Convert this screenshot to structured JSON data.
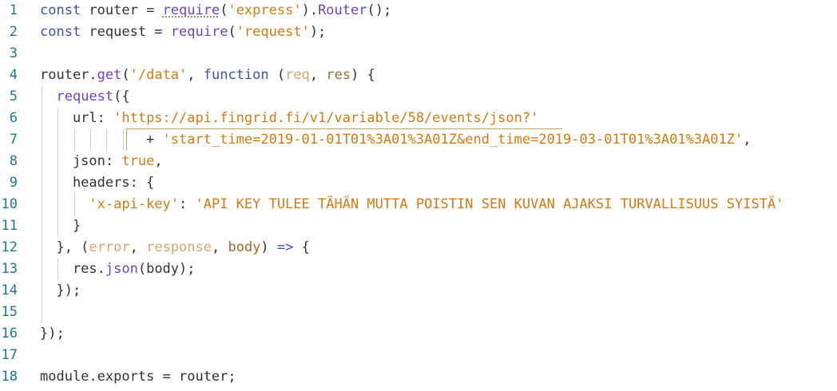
{
  "editor": {
    "lines": [
      {
        "number": "1",
        "tokens": [
          {
            "t": "const",
            "c": "kw"
          },
          {
            "t": " router = "
          },
          {
            "t": "require",
            "c": "fn squiggle"
          },
          {
            "t": "("
          },
          {
            "t": "'express'",
            "c": "str"
          },
          {
            "t": ")."
          },
          {
            "t": "Router",
            "c": "fn"
          },
          {
            "t": "();"
          }
        ]
      },
      {
        "number": "2",
        "tokens": [
          {
            "t": "const",
            "c": "kw"
          },
          {
            "t": " request = "
          },
          {
            "t": "require",
            "c": "fn"
          },
          {
            "t": "("
          },
          {
            "t": "'request'",
            "c": "str"
          },
          {
            "t": ");"
          }
        ]
      },
      {
        "number": "3",
        "tokens": []
      },
      {
        "number": "4",
        "tokens": [
          {
            "t": "router."
          },
          {
            "t": "get",
            "c": "fn"
          },
          {
            "t": "("
          },
          {
            "t": "'/data'",
            "c": "str"
          },
          {
            "t": ", "
          },
          {
            "t": "function",
            "c": "kw"
          },
          {
            "t": " ("
          },
          {
            "t": "req",
            "c": "param"
          },
          {
            "t": ", "
          },
          {
            "t": "res",
            "c": "arg"
          },
          {
            "t": ") {"
          }
        ]
      },
      {
        "number": "5",
        "tokens": [
          {
            "t": "  "
          },
          {
            "t": "request",
            "c": "fn"
          },
          {
            "t": "({"
          }
        ]
      },
      {
        "number": "6",
        "tokens": [
          {
            "t": "    url: "
          },
          {
            "t": "'https://api.fingrid.fi/v1/variable/58/events/json?'",
            "c": "str"
          }
        ]
      },
      {
        "number": "7",
        "tokens": [
          {
            "t": "             + "
          },
          {
            "t": "'start_time=2019-01-01T01%3A01%3A01Z&end_time=2019-03-01T01%3A01%3A01Z'",
            "c": "str"
          },
          {
            "t": ","
          }
        ]
      },
      {
        "number": "8",
        "tokens": [
          {
            "t": "    json: "
          },
          {
            "t": "true",
            "c": "str"
          },
          {
            "t": ","
          }
        ]
      },
      {
        "number": "9",
        "tokens": [
          {
            "t": "    headers: {"
          }
        ]
      },
      {
        "number": "10",
        "tokens": [
          {
            "t": "      "
          },
          {
            "t": "'x-api-key'",
            "c": "str"
          },
          {
            "t": ": "
          },
          {
            "t": "'API KEY TULEE TÄHÄN MUTTA POISTIN SEN KUVAN AJAKSI TURVALLISUUS SYISTÄ'",
            "c": "str"
          }
        ]
      },
      {
        "number": "11",
        "tokens": [
          {
            "t": "    }"
          }
        ]
      },
      {
        "number": "12",
        "tokens": [
          {
            "t": "  }, ("
          },
          {
            "t": "error",
            "c": "param"
          },
          {
            "t": ", "
          },
          {
            "t": "response",
            "c": "param"
          },
          {
            "t": ", "
          },
          {
            "t": "body",
            "c": "arg"
          },
          {
            "t": ") "
          },
          {
            "t": "=>",
            "c": "kw"
          },
          {
            "t": " {"
          }
        ]
      },
      {
        "number": "13",
        "tokens": [
          {
            "t": "    res."
          },
          {
            "t": "json",
            "c": "fn"
          },
          {
            "t": "(body);"
          }
        ]
      },
      {
        "number": "14",
        "tokens": [
          {
            "t": "  });"
          }
        ]
      },
      {
        "number": "15",
        "tokens": []
      },
      {
        "number": "16",
        "tokens": [
          {
            "t": "});"
          }
        ]
      },
      {
        "number": "17",
        "tokens": []
      },
      {
        "number": "18",
        "tokens": [
          {
            "t": "module.exports = router;"
          }
        ]
      }
    ]
  },
  "colors": {
    "background": "#ffffff",
    "line_number": "#237893",
    "keyword": "#3b53a8",
    "function": "#6f42c1",
    "string": "#d47a13",
    "text": "#333333"
  }
}
